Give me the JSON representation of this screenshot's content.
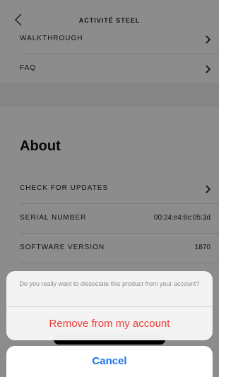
{
  "nav": {
    "title": "ACTIVITÉ STEEL"
  },
  "top_rows": [
    {
      "label": "WALKTHROUGH"
    },
    {
      "label": "FAQ"
    }
  ],
  "about": {
    "heading": "About",
    "rows": [
      {
        "label": "CHECK FOR UPDATES"
      },
      {
        "label": "SERIAL NUMBER",
        "value": "00:24:e4:6c:05:3d"
      },
      {
        "label": "SOFTWARE VERSION",
        "value": "1870"
      }
    ]
  },
  "action_sheet": {
    "message": "Do you really want to dissociate this product from your account?",
    "destructive_label": "Remove from my account",
    "cancel_label": "Cancel"
  },
  "colors": {
    "destructive": "#ef3b35",
    "cancel": "#1a73e8",
    "overlay": "rgba(0,0,0,0.45)"
  }
}
